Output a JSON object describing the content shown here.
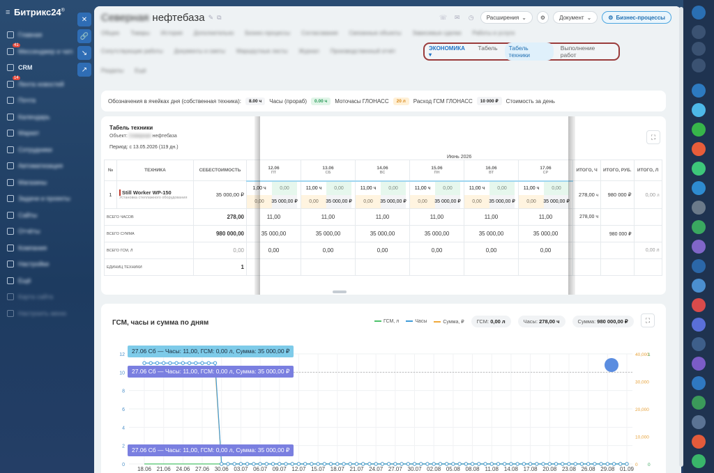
{
  "brand": {
    "name": "Битрикс24",
    "sup": "®"
  },
  "sidebar": {
    "items": [
      {
        "label": "Главная",
        "badge": ""
      },
      {
        "label": "Мессенджер и чаты",
        "badge": "41"
      },
      {
        "label": "CRM",
        "badge": ""
      },
      {
        "label": "Лента новостей",
        "badge": "14"
      },
      {
        "label": "Почта",
        "badge": ""
      },
      {
        "label": "Календарь",
        "badge": ""
      },
      {
        "label": "Маркет",
        "badge": ""
      },
      {
        "label": "Сотрудники",
        "badge": ""
      },
      {
        "label": "Автоматизация",
        "badge": ""
      },
      {
        "label": "Магазины",
        "badge": ""
      },
      {
        "label": "Задачи и проекты",
        "badge": ""
      },
      {
        "label": "Сайты",
        "badge": ""
      },
      {
        "label": "Отчёты",
        "badge": ""
      },
      {
        "label": "Компания",
        "badge": ""
      },
      {
        "label": "Настройки",
        "badge": ""
      },
      {
        "label": "Ещё",
        "badge": ""
      },
      {
        "label": "Карта сайта",
        "badge": ""
      },
      {
        "label": "Настроить меню",
        "badge": ""
      }
    ]
  },
  "header": {
    "title_blurred": "Северная",
    "title": "нефтебаза",
    "extensions": "Расширения",
    "document": "Документ",
    "business_processes": "Бизнес-процессы"
  },
  "tabs_row1": [
    "Общее",
    "Товары",
    "История",
    "Дополнительно",
    "Бизнес-процессы",
    "Согласования",
    "Связанные объекты",
    "Зависимые сделки",
    "Работы и услуги"
  ],
  "tabs_row2": [
    "Сопутствующие работы",
    "Документы и сметы",
    "Маршрутные листы",
    "Журнал",
    "Производственный отчёт"
  ],
  "tabs_row3": [
    "Разделы",
    "Ещё"
  ],
  "economy": {
    "menu": "ЭКОНОМИКА",
    "tabs": [
      "Табель",
      "Табель техники",
      "Выполнение работ"
    ],
    "active": 1
  },
  "legend_bar": {
    "caption": "Обозначения в ячейках дня (собственная техника):",
    "items": [
      {
        "chip": "8.00 ч",
        "label": "Часы (прораб)",
        "bg": "#f3f4f6",
        "fg": "#222"
      },
      {
        "chip": "0.00 ч",
        "label": "Моточасы ГЛОНАСС",
        "bg": "#e1f5e8",
        "fg": "#2a9b59"
      },
      {
        "chip": "20 л",
        "label": "Расход ГСМ ГЛОНАСС",
        "bg": "#fff0d6",
        "fg": "#d98a1c"
      },
      {
        "chip": "10 000 ₽",
        "label": "Стоимость за день",
        "bg": "#f3f4f6",
        "fg": "#222"
      }
    ]
  },
  "timesheet": {
    "title": "Табель техники",
    "object_label": "Объект:",
    "object_blurred": "Северная",
    "object_name": "нефтебаза",
    "period": "Период: с 13.05.2026 (119 дн.)",
    "month": "Июнь 2026",
    "col_num": "№",
    "col_tech": "Техника",
    "col_cost": "Себестоимость",
    "days": [
      {
        "date": "12.06",
        "dow": "Пт"
      },
      {
        "date": "13.06",
        "dow": "Сб"
      },
      {
        "date": "14.06",
        "dow": "Вс"
      },
      {
        "date": "15.06",
        "dow": "Пн"
      },
      {
        "date": "16.06",
        "dow": "Вт"
      },
      {
        "date": "17.06",
        "dow": "Ср"
      }
    ],
    "col_total_h": "Итого, ч",
    "col_total_rub": "Итого, руб.",
    "col_total_l": "Итого, л",
    "row": {
      "num": "1",
      "name": "Still Worker WP-150",
      "sub": "Установка стеллажного оборудования",
      "cost": "35 000,00 ₽",
      "hours": "11,00 ч",
      "moto": "0,00",
      "fuel": "0,00",
      "sum": "35 000,00 ₽",
      "first_hours": "1,00 ч",
      "first_fuel": "0,00",
      "total_h": "278,00",
      "total_h_unit": "ч",
      "total_rub": "980 000 ₽",
      "total_l": "0,00",
      "total_l_unit": "л"
    },
    "summary": [
      {
        "label": "Всего часов",
        "value": "278,00",
        "day": "11,00",
        "total_h": "278,00 ч",
        "total_rub": "",
        "total_l": ""
      },
      {
        "label": "Всего сумма",
        "value": "980 000,00",
        "day": "35 000,00",
        "total_h": "",
        "total_rub": "980 000 ₽",
        "total_l": ""
      },
      {
        "label": "Всего ГСМ, л",
        "value": "0,00",
        "day": "0,00",
        "total_h": "",
        "total_rub": "",
        "total_l": "0,00 л"
      },
      {
        "label": "Единиц техники",
        "value": "1",
        "day": "",
        "total_h": "",
        "total_rub": "",
        "total_l": ""
      }
    ]
  },
  "chart": {
    "title": "ГСМ, часы и сумма по дням",
    "legend": [
      {
        "label": "ГСМ, л",
        "color": "#4cc26a"
      },
      {
        "label": "Часы",
        "color": "#3f9bd8"
      },
      {
        "label": "Сумма, ₽",
        "color": "#f0a93a"
      }
    ],
    "stats": [
      {
        "label": "ГСМ:",
        "value": "0,00 л"
      },
      {
        "label": "Часы:",
        "value": "278,00 ч"
      },
      {
        "label": "Сумма:",
        "value": "980 000,00 ₽"
      }
    ],
    "tooltip_text": "27.06 Сб — Часы: 11,00, ГСМ: 0,00 л, Сумма: 35 000,00 ₽"
  },
  "chart_data": {
    "type": "line",
    "title": "ГСМ, часы и сумма по дням",
    "x": [
      "18.06",
      "21.06",
      "24.06",
      "27.06",
      "30.06",
      "03.07",
      "06.07",
      "09.07",
      "12.07",
      "15.07",
      "18.07",
      "21.07",
      "24.07",
      "27.07",
      "30.07",
      "02.08",
      "05.08",
      "08.08",
      "11.08",
      "14.08",
      "17.08",
      "20.08",
      "23.08",
      "26.08",
      "29.08",
      "01.09"
    ],
    "yaxis_left": {
      "ticks": [
        0,
        2,
        4,
        6,
        8,
        10,
        12
      ]
    },
    "yaxis_right_sum": {
      "ticks": [
        0,
        10000,
        20000,
        30000,
        40000
      ],
      "tick_labels": [
        "0",
        "10,000",
        "20,000",
        "30,000",
        "40,000"
      ]
    },
    "yaxis_right_fuel": {
      "ticks": [
        0,
        1
      ],
      "tick_labels": [
        "0",
        "1"
      ]
    },
    "series": [
      {
        "name": "Часы",
        "color": "#3f9bd8",
        "values_note": "11 until 27.06, then 0",
        "values": [
          11,
          11,
          11,
          11,
          0,
          0,
          0,
          0,
          0,
          0,
          0,
          0,
          0,
          0,
          0,
          0,
          0,
          0,
          0,
          0,
          0,
          0,
          0,
          0,
          0,
          0
        ]
      },
      {
        "name": "Сумма, ₽",
        "color": "#f0a93a",
        "values": [
          35000,
          35000,
          35000,
          35000,
          0,
          0,
          0,
          0,
          0,
          0,
          0,
          0,
          0,
          0,
          0,
          0,
          0,
          0,
          0,
          0,
          0,
          0,
          0,
          0,
          0,
          0
        ]
      },
      {
        "name": "ГСМ, л",
        "color": "#4cc26a",
        "values": [
          0,
          0,
          0,
          0,
          0,
          0,
          0,
          0,
          0,
          0,
          0,
          0,
          0,
          0,
          0,
          0,
          0,
          0,
          0,
          0,
          0,
          0,
          0,
          0,
          0,
          0
        ]
      }
    ]
  }
}
